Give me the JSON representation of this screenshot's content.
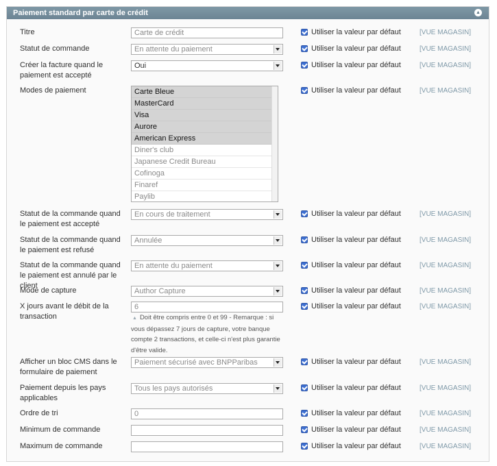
{
  "panel": {
    "title": "Paiement standard par carte de crédit",
    "collapse_icon": "chevron-up-icon"
  },
  "default_label": "Utiliser la valeur par défaut",
  "scope_label": "[VUE MAGASIN]",
  "fields": {
    "title": {
      "label": "Titre",
      "value": "Carte de crédit"
    },
    "order_status": {
      "label": "Statut de commande",
      "value": "En attente du paiement"
    },
    "create_invoice": {
      "label": "Créer la facture quand le paiement est accepté",
      "value": "Oui"
    },
    "payment_modes": {
      "label": "Modes de paiement",
      "options": [
        {
          "label": "Carte Bleue",
          "selected": true
        },
        {
          "label": "MasterCard",
          "selected": true
        },
        {
          "label": "Visa",
          "selected": true
        },
        {
          "label": "Aurore",
          "selected": true
        },
        {
          "label": "American Express",
          "selected": true
        },
        {
          "label": "Diner's club",
          "selected": false
        },
        {
          "label": "Japanese Credit Bureau",
          "selected": false
        },
        {
          "label": "Cofinoga",
          "selected": false
        },
        {
          "label": "Finaref",
          "selected": false
        },
        {
          "label": "Paylib",
          "selected": false
        }
      ]
    },
    "status_accepted": {
      "label": "Statut de la commande quand le paiement est accepté",
      "value": "En cours de traitement"
    },
    "status_refused": {
      "label": "Statut de la commande quand le paiement est refusé",
      "value": "Annulée"
    },
    "status_cancelled": {
      "label": "Statut de la commande quand le paiement est annulé par le client",
      "value": "En attente du paiement"
    },
    "capture_mode": {
      "label": "Mode de capture",
      "value": "Author Capture"
    },
    "capture_days": {
      "label": "X jours avant le débit de la transaction",
      "value": "6",
      "note": "Doit être compris entre 0 et 99 - Remarque : si vous dépassez 7 jours de capture, votre banque compte 2 transactions, et celle-ci n'est plus garantie d'être valide."
    },
    "cms_block": {
      "label": "Afficher un bloc CMS dans le formulaire de paiement",
      "value": "Paiement sécurisé avec BNPParibas"
    },
    "countries": {
      "label": "Paiement depuis les pays applicables",
      "value": "Tous les pays autorisés"
    },
    "sort_order": {
      "label": "Ordre de tri",
      "value": "0"
    },
    "min_order": {
      "label": "Minimum de commande",
      "value": ""
    },
    "max_order": {
      "label": "Maximum de commande",
      "value": ""
    }
  }
}
